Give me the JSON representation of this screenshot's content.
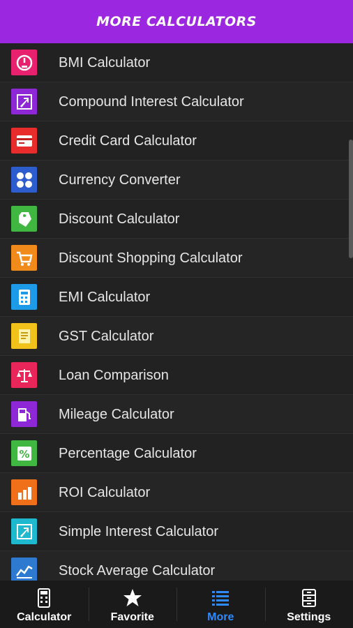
{
  "header": {
    "title": "MORE CALCULATORS"
  },
  "items": [
    {
      "label": "BMI Calculator",
      "icon": "gauge-icon",
      "color": "#e8216f"
    },
    {
      "label": "Compound Interest Calculator",
      "icon": "arrow-up-right-icon",
      "color": "#8e27d6"
    },
    {
      "label": "Credit Card Calculator",
      "icon": "credit-card-icon",
      "color": "#e82b2b"
    },
    {
      "label": "Currency Converter",
      "icon": "currency-icon",
      "color": "#2d5ccf"
    },
    {
      "label": "Discount Calculator",
      "icon": "tag-icon",
      "color": "#3fb740"
    },
    {
      "label": "Discount Shopping Calculator",
      "icon": "cart-icon",
      "color": "#f08a1a"
    },
    {
      "label": "EMI Calculator",
      "icon": "calculator-icon",
      "color": "#1e9be8"
    },
    {
      "label": "GST Calculator",
      "icon": "receipt-icon",
      "color": "#f0c21a"
    },
    {
      "label": "Loan Comparison",
      "icon": "scale-icon",
      "color": "#e8265a"
    },
    {
      "label": "Mileage Calculator",
      "icon": "fuel-pump-icon",
      "color": "#8e27d6"
    },
    {
      "label": "Percentage Calculator",
      "icon": "percent-icon",
      "color": "#3fb740"
    },
    {
      "label": "ROI Calculator",
      "icon": "roi-icon",
      "color": "#f0701a"
    },
    {
      "label": "Simple Interest Calculator",
      "icon": "arrow-up-right-icon",
      "color": "#1eb8cf"
    },
    {
      "label": "Stock Average Calculator",
      "icon": "stock-chart-icon",
      "color": "#2d7ad0"
    }
  ],
  "tabs": [
    {
      "label": "Calculator",
      "icon": "calculator-icon",
      "active": false
    },
    {
      "label": "Favorite",
      "icon": "star-icon",
      "active": false
    },
    {
      "label": "More",
      "icon": "list-icon",
      "active": true
    },
    {
      "label": "Settings",
      "icon": "settings-icon",
      "active": false
    }
  ]
}
